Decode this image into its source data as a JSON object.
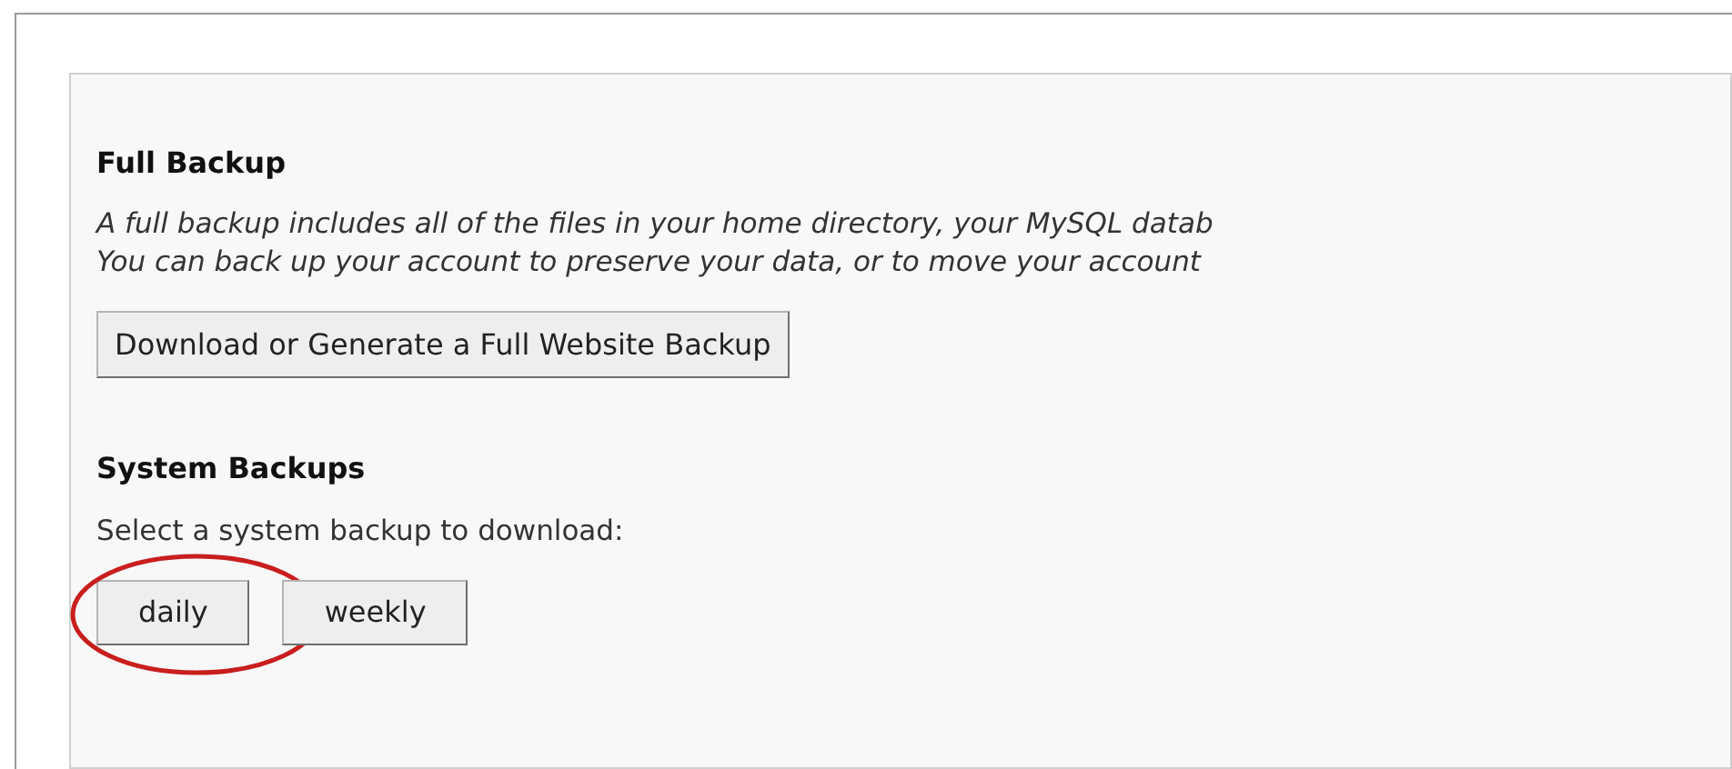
{
  "full_backup": {
    "title": "Full Backup",
    "description": [
      "A full backup includes all of the files in your home directory, your MySQL datab",
      "You can back up your account to preserve your data, or to move your account"
    ],
    "button": "Download or Generate a Full Website Backup"
  },
  "system_backups": {
    "title": "System Backups",
    "prompt": "Select a system backup to download:",
    "buttons": [
      {
        "label": "daily",
        "highlighted": true
      },
      {
        "label": "weekly",
        "highlighted": false
      }
    ]
  }
}
